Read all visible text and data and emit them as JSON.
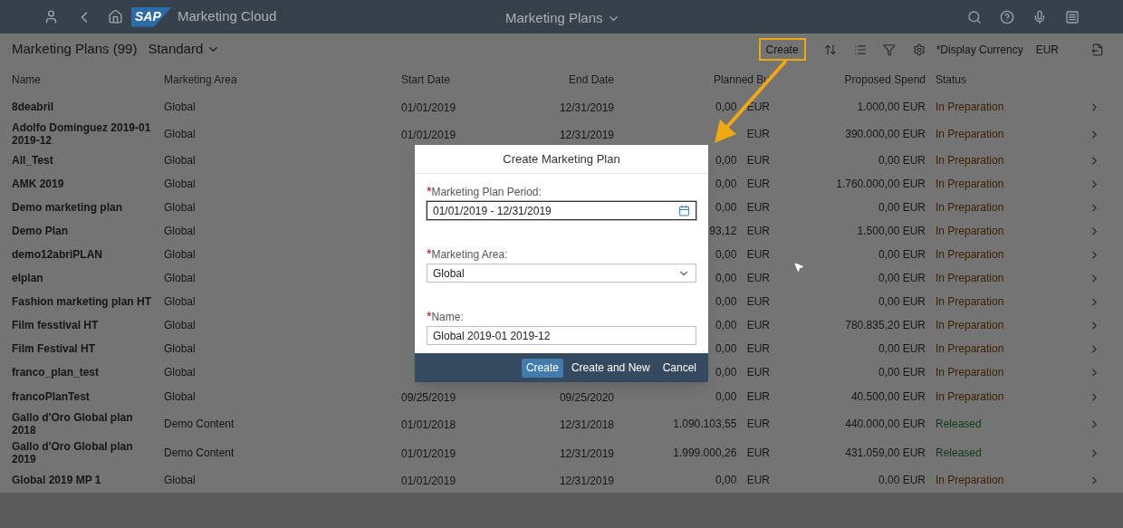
{
  "shell": {
    "logo": "SAP",
    "app_title": "Marketing Cloud",
    "page_title": "Marketing Plans"
  },
  "toolbar": {
    "title": "Marketing Plans (99)",
    "variant": "Standard",
    "create": "Create",
    "currency_label": "*Display Currency",
    "currency": "EUR"
  },
  "table": {
    "columns": [
      "Name",
      "Marketing Area",
      "Start Date",
      "End Date",
      "Planned Bu",
      "Proposed Spend",
      "Status"
    ],
    "rows": [
      {
        "name": "8deabril",
        "area": "Global",
        "start": "01/01/2019",
        "end": "12/31/2019",
        "planned": "0,00 EUR",
        "proposed": "1.000,00 EUR",
        "status": "In Preparation",
        "color": "#3d2200"
      },
      {
        "name": "Adolfo Dominguez 2019-01 2019-12",
        "area": "Global",
        "start": "01/01/2019",
        "end": "12/31/2019",
        "planned": "EUR",
        "proposed": "390.000,00 EUR",
        "status": "In Preparation",
        "color": "#3d2200"
      },
      {
        "name": "All_Test",
        "area": "Global",
        "planned": "0,00 EUR",
        "proposed": "0,00 EUR",
        "status": "In Preparation",
        "color": "#3d2200"
      },
      {
        "name": "AMK 2019",
        "area": "Global",
        "planned": "0,00 EUR",
        "proposed": "1.760.000,00 EUR",
        "status": "In Preparation",
        "color": "#3d2200"
      },
      {
        "name": "Demo marketing plan",
        "area": "Global",
        "planned": "0,00 EUR",
        "proposed": "0,00 EUR",
        "status": "In Preparation",
        "color": "#3d2200"
      },
      {
        "name": "Demo Plan",
        "area": "Global",
        "planned": "93,12 EUR",
        "proposed": "1.500,00 EUR",
        "status": "In Preparation",
        "color": "#3d2200"
      },
      {
        "name": "demo12abriPLAN",
        "area": "Global",
        "planned": "0,00 EUR",
        "proposed": "0,00 EUR",
        "status": "In Preparation",
        "color": "#3d2200"
      },
      {
        "name": "elplan",
        "area": "Global",
        "planned": "0,00 EUR",
        "proposed": "0,00 EUR",
        "status": "In Preparation",
        "color": "#3d2200"
      },
      {
        "name": "Fashion marketing plan HT",
        "area": "Global",
        "planned": "0,00 EUR",
        "proposed": "0,00 EUR",
        "status": "In Preparation",
        "color": "#3d2200"
      },
      {
        "name": "Film fesstival HT",
        "area": "Global",
        "planned": "0,00 EUR",
        "proposed": "780.835,20 EUR",
        "status": "In Preparation",
        "color": "#3d2200"
      },
      {
        "name": "Film Festival HT",
        "area": "Global",
        "planned": "0,00 EUR",
        "proposed": "0,00 EUR",
        "status": "In Preparation",
        "color": "#3d2200"
      },
      {
        "name": "franco_plan_test",
        "area": "Global",
        "planned": "0,00 EUR",
        "proposed": "0,00 EUR",
        "status": "In Preparation",
        "color": "#3d2200"
      },
      {
        "name": "francoPlanTest",
        "area": "Global",
        "start": "09/25/2019",
        "end": "09/25/2020",
        "planned": "0,00 EUR",
        "proposed": "40.500,00 EUR",
        "status": "In Preparation",
        "color": "#3d2200"
      },
      {
        "name": "Gallo d'Oro Global plan 2018",
        "area": "Demo Content",
        "start": "01/01/2018",
        "end": "12/31/2018",
        "planned": "1.090.103,55 EUR",
        "proposed": "440.000,00 EUR",
        "status": "Released",
        "color": "#0d3a1a"
      },
      {
        "name": "Gallo d'Oro Global plan 2019",
        "area": "Demo Content",
        "start": "01/01/2019",
        "end": "12/31/2019",
        "planned": "1.999.000,26 EUR",
        "proposed": "431.059,00 EUR",
        "status": "Released",
        "color": "#0d3a1a"
      },
      {
        "name": "Global 2019 MP 1",
        "area": "Global",
        "start": "01/01/2019",
        "end": "12/31/2019",
        "planned": "0,00 EUR",
        "proposed": "0,00 EUR",
        "status": "In Preparation",
        "color": "#3d2200"
      }
    ]
  },
  "dialog": {
    "title": "Create Marketing Plan",
    "fields": [
      {
        "kind": "date",
        "required_mark": "*",
        "label": "Marketing Plan Period:",
        "value": "01/01/2019 - 12/31/2019",
        "focused": true
      },
      {
        "kind": "select",
        "required_mark": "*",
        "label": "Marketing Area:",
        "value": "Global",
        "focused": false
      },
      {
        "kind": "text",
        "required_mark": "*",
        "label": "Name:",
        "value": "Global 2019-01 2019-12",
        "focused": false
      }
    ],
    "buttons": [
      {
        "label": "Create",
        "emphasized": true
      },
      {
        "label": "Create and New",
        "emphasized": false
      },
      {
        "label": "Cancel",
        "emphasized": false
      }
    ]
  }
}
